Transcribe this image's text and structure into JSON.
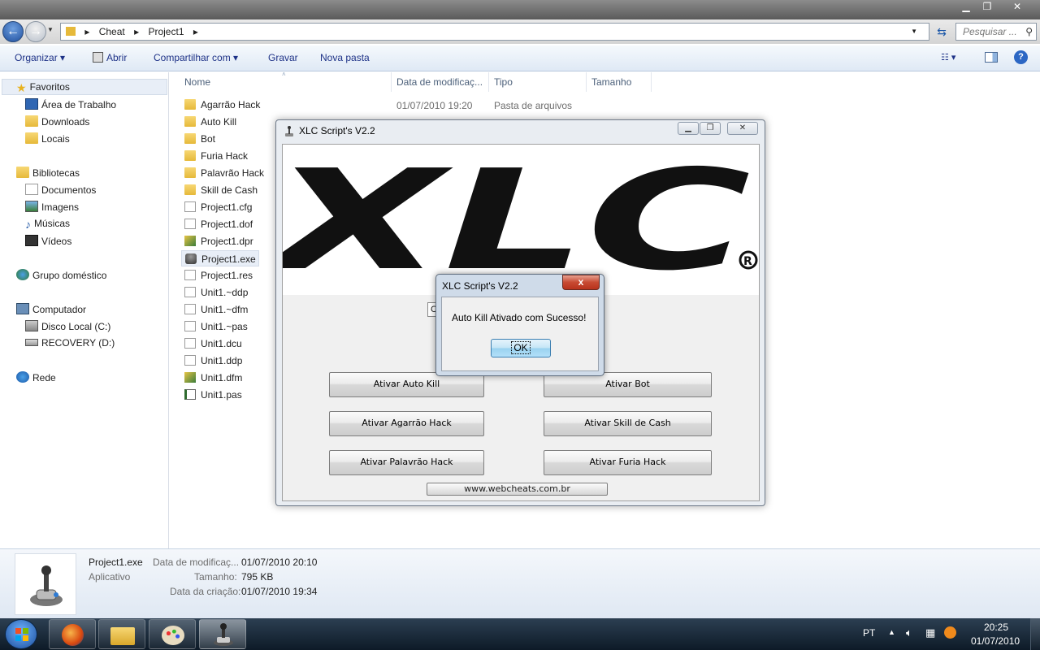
{
  "explorer": {
    "breadcrumb": [
      "Cheat",
      "Project1"
    ],
    "search_placeholder": "Pesquisar ...",
    "toolbar": {
      "organizar": "Organizar",
      "abrir": "Abrir",
      "compartilhar": "Compartilhar com",
      "gravar": "Gravar",
      "nova_pasta": "Nova pasta"
    },
    "nav": {
      "favoritos": "Favoritos",
      "area_trabalho": "Área de Trabalho",
      "downloads": "Downloads",
      "locais": "Locais",
      "bibliotecas": "Bibliotecas",
      "documentos": "Documentos",
      "imagens": "Imagens",
      "musicas": "Músicas",
      "videos": "Vídeos",
      "grupo": "Grupo doméstico",
      "computador": "Computador",
      "disco_c": "Disco Local (C:)",
      "recovery": "RECOVERY (D:)",
      "rede": "Rede"
    },
    "columns": {
      "nome": "Nome",
      "data": "Data de modificaç...",
      "tipo": "Tipo",
      "tamanho": "Tamanho"
    },
    "files": [
      {
        "name": "Agarrão Hack",
        "date": "01/07/2010 19:20",
        "type": "Pasta de arquivos"
      },
      {
        "name": "Auto Kill"
      },
      {
        "name": "Bot"
      },
      {
        "name": "Furia Hack"
      },
      {
        "name": "Palavrão Hack"
      },
      {
        "name": "Skill de Cash"
      },
      {
        "name": "Project1.cfg"
      },
      {
        "name": "Project1.dof"
      },
      {
        "name": "Project1.dpr"
      },
      {
        "name": "Project1.exe"
      },
      {
        "name": "Project1.res"
      },
      {
        "name": "Unit1.~ddp"
      },
      {
        "name": "Unit1.~dfm"
      },
      {
        "name": "Unit1.~pas"
      },
      {
        "name": "Unit1.dcu"
      },
      {
        "name": "Unit1.ddp"
      },
      {
        "name": "Unit1.dfm"
      },
      {
        "name": "Unit1.pas"
      }
    ],
    "details": {
      "name": "Project1.exe",
      "kind": "Aplicativo",
      "mod_label": "Data de modificaç...",
      "mod_value": "01/07/2010 20:10",
      "size_label": "Tamanho:",
      "size_value": "795 KB",
      "created_label": "Data da criação:",
      "created_value": "01/07/2010 19:34"
    }
  },
  "app": {
    "title": "XLC Script's V2.2",
    "logo_text": "XLC",
    "partial_text": "C",
    "buttons": {
      "auto_kill": "Ativar Auto Kill",
      "bot": "Ativar Bot",
      "agarrao": "Ativar Agarrão Hack",
      "skill": "Ativar Skill de Cash",
      "palavrao": "Ativar Palavrão Hack",
      "furia": "Ativar Furia Hack"
    },
    "url": "www.webcheats.com.br"
  },
  "dialog": {
    "title": "XLC Script's V2.2",
    "message": "Auto Kill Ativado com Sucesso!",
    "ok": "OK",
    "close": "x"
  },
  "taskbar": {
    "lang": "PT",
    "time": "20:25",
    "date": "01/07/2010"
  }
}
